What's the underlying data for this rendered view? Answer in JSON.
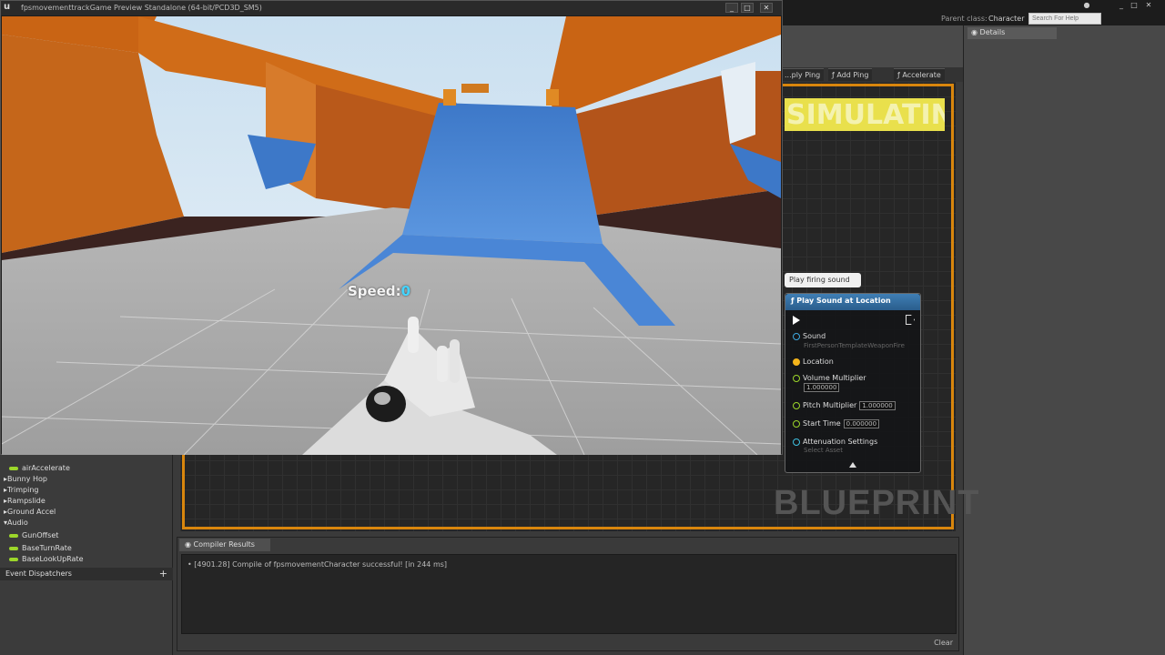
{
  "game_window": {
    "title": "fpsmovementtrackGame Preview Standalone (64-bit/PCD3D_SM5)",
    "buttons": [
      "_",
      "□",
      "✕"
    ]
  },
  "hud": {
    "speed_label": "Speed:",
    "speed_value": "0"
  },
  "topbar": {
    "parent_class_label": "Parent class:",
    "parent_class_value": "Character",
    "search_placeholder": "Search For Help"
  },
  "details_tab": "Details",
  "graph_tabs": [
    "...ply Ping",
    "Add Ping",
    "Accelerate"
  ],
  "simulating_text": "SIMULATING",
  "watermark": "BLUEPRINT",
  "comment_bubble": "Play firing sound",
  "node": {
    "title": "Play Sound at Location",
    "pins": {
      "sound": {
        "label": "Sound",
        "value": "FirstPersonTemplateWeaponFire"
      },
      "location": {
        "label": "Location"
      },
      "volume": {
        "label": "Volume Multiplier",
        "value": "1.000000"
      },
      "pitch": {
        "label": "Pitch Multiplier",
        "value": "1.000000"
      },
      "start_time": {
        "label": "Start Time",
        "value": "0.000000"
      },
      "attenuation": {
        "label": "Attenuation Settings",
        "value": "Select Asset"
      }
    }
  },
  "left_panel": {
    "items": [
      {
        "label": "airAccelerate",
        "type": "var"
      },
      {
        "label": "Bunny Hop",
        "type": "category"
      },
      {
        "label": "Trimping",
        "type": "category"
      },
      {
        "label": "Rampslide",
        "type": "category"
      },
      {
        "label": "Ground Accel",
        "type": "category"
      },
      {
        "label": "Audio",
        "type": "category"
      },
      {
        "label": "GunOffset",
        "type": "var"
      },
      {
        "label": "BaseTurnRate",
        "type": "var"
      },
      {
        "label": "BaseLookUpRate",
        "type": "var"
      }
    ],
    "event_dispatchers": "Event Dispatchers",
    "event_add": "+"
  },
  "compiler": {
    "tab_label": "Compiler Results",
    "message": "[4901.28] Compile of fpsmovementCharacter successful! [in 244 ms]",
    "clear_label": "Clear"
  },
  "colors": {
    "accent_orange": "#d9860d",
    "node_header": "#3f7fb5",
    "speed_value": "#44d4ff"
  }
}
